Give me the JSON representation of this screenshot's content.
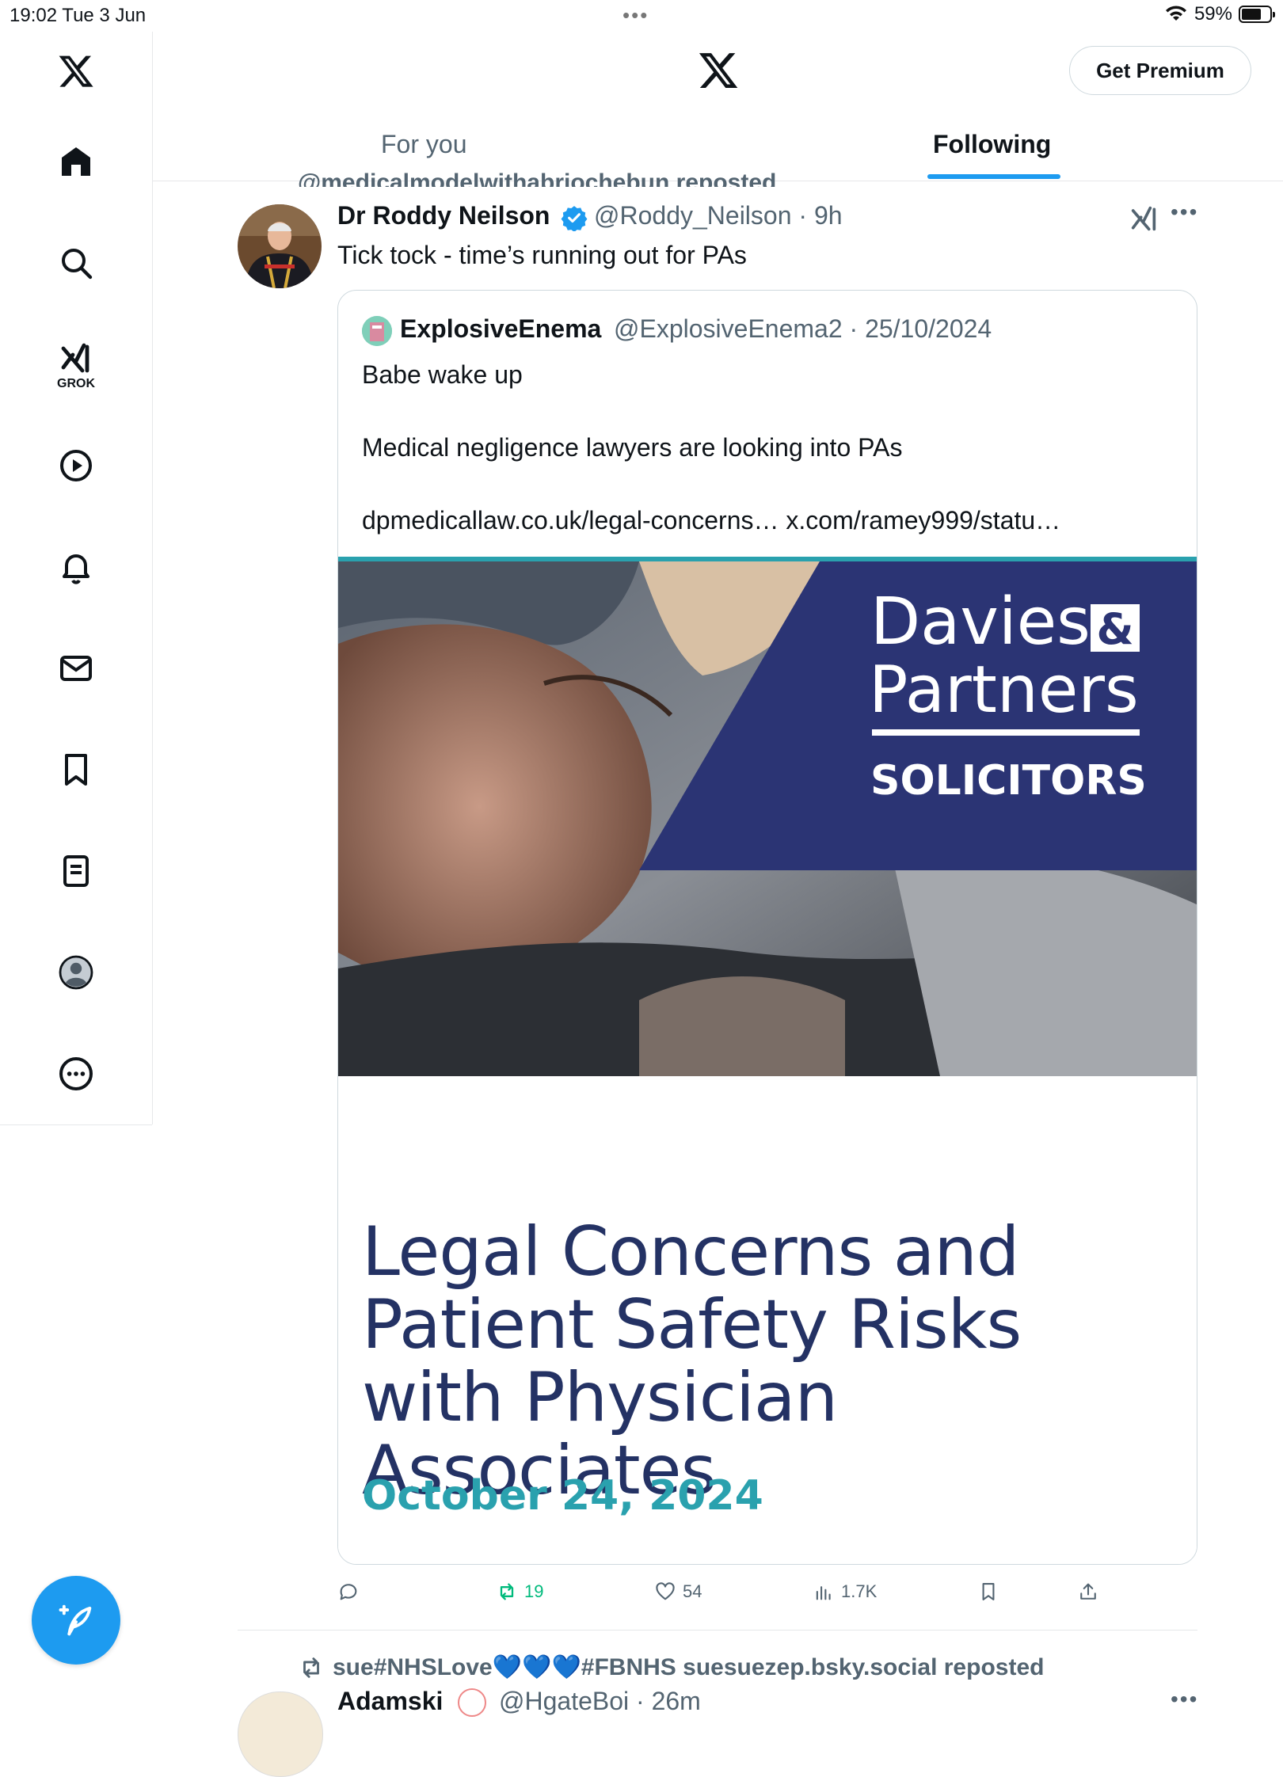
{
  "status_bar": {
    "time": "19:02  Tue 3 Jun",
    "battery": "59%",
    "battery_level": 0.59
  },
  "sidebar": {
    "items": [
      {
        "icon": "x-logo-icon"
      },
      {
        "icon": "home-icon"
      },
      {
        "icon": "search-icon"
      },
      {
        "icon": "grok-icon",
        "label": "GROK"
      },
      {
        "icon": "video-play-icon"
      },
      {
        "icon": "bell-icon"
      },
      {
        "icon": "mail-icon"
      },
      {
        "icon": "bookmark-icon"
      },
      {
        "icon": "lists-icon"
      },
      {
        "icon": "profile-icon"
      },
      {
        "icon": "more-icon"
      }
    ],
    "compose_icon": "feather-plus-icon"
  },
  "header": {
    "premium_label": "Get Premium",
    "tabs": [
      {
        "label": "For you",
        "active": false
      },
      {
        "label": "Following",
        "active": true
      }
    ]
  },
  "feed": {
    "partial_repost_line": "@medicalmodelwithabriochebun reposted",
    "tweet1": {
      "name": "Dr Roddy Neilson",
      "meta": "@Roddy_Neilson · 9h",
      "text": "Tick tock - time’s running out for PAs",
      "quote": {
        "name": "ExplosiveEnema",
        "meta": "@ExplosiveEnema2 · 25/10/2024",
        "line1": "Babe wake up",
        "line2": "Medical negligence lawyers are looking into PAs",
        "line3": "dpmedicallaw.co.uk/legal-concerns… x.com/ramey999/statu…",
        "card": {
          "brand_line1": "Davies",
          "brand_amp": "&",
          "brand_line2": "Partners",
          "brand_line3": "SOLICITORS",
          "title": "Legal Concerns and Patient Safety Risks with Physician Associates",
          "date": "October 24, 2024"
        }
      },
      "actions": {
        "reply": "",
        "retweets": "19",
        "likes": "54",
        "views": "1.7K"
      }
    },
    "tweet2": {
      "repost_line": "sue#NHSLove💙💙💙#FBNHS suesuezep.bsky.social reposted",
      "name": "Adamski",
      "meta": "@HgateBoi · 26m"
    }
  },
  "colors": {
    "accent": "#1d9bf0",
    "brand_navy": "#2b3474",
    "card_title": "#243264",
    "card_date": "#2aa1ae",
    "retweet_green": "#00ba7c"
  }
}
